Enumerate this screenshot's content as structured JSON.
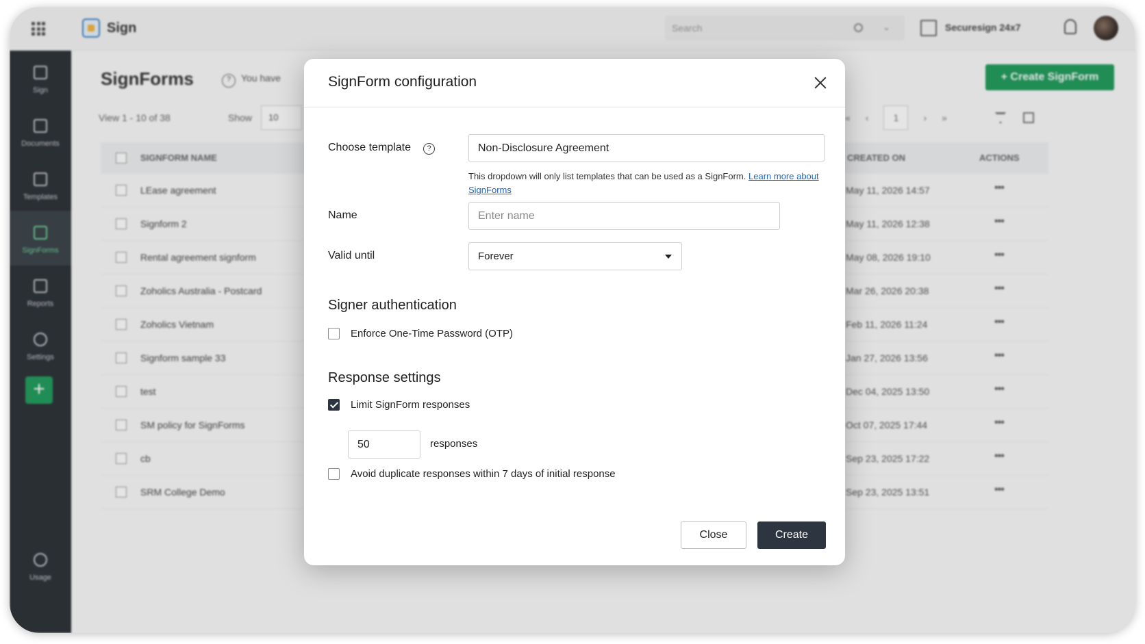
{
  "header": {
    "app_name": "Sign",
    "search_placeholder": "Search",
    "org_name": "Securesign 24x7",
    "icons": [
      "apps-grid-icon",
      "sign-logo-icon",
      "search-icon",
      "chevron-down-icon",
      "organization-icon",
      "bell-icon"
    ]
  },
  "sidebar": {
    "items": [
      {
        "label": "Sign",
        "icon": "home-icon"
      },
      {
        "label": "Documents",
        "icon": "documents-icon"
      },
      {
        "label": "Templates",
        "icon": "templates-icon"
      },
      {
        "label": "SignForms",
        "icon": "link-icon",
        "active": true
      },
      {
        "label": "Reports",
        "icon": "reports-icon"
      },
      {
        "label": "Settings",
        "icon": "gear-icon"
      }
    ],
    "usage_label": "Usage"
  },
  "page": {
    "title": "SignForms",
    "info_note": "You have",
    "create_button": "+ Create SignForm",
    "view_count": "View  1 - 10  of  38",
    "show_label": "Show",
    "show_value": "10",
    "current_page": "1",
    "pager": {
      "first": "«",
      "prev": "‹",
      "next": "›",
      "last": "»"
    }
  },
  "table": {
    "headers": {
      "name": "SIGNFORM NAME",
      "created": "CREATED ON",
      "actions": "ACTIONS"
    },
    "rows": [
      {
        "name": "LEase agreement",
        "created": "May 11, 2026 14:57"
      },
      {
        "name": "Signform 2",
        "created": "May 11, 2026 12:38"
      },
      {
        "name": "Rental agreement signform",
        "created": "May 08, 2026 19:10"
      },
      {
        "name": "Zoholics Australia - Postcard",
        "created": "Mar 26, 2026 20:38"
      },
      {
        "name": "Zoholics Vietnam",
        "created": "Feb 11, 2026 11:24"
      },
      {
        "name": "Signform sample 33",
        "created": "Jan 27, 2026 13:56"
      },
      {
        "name": "test",
        "created": "Dec 04, 2025 13:50"
      },
      {
        "name": "SM policy for SignForms",
        "created": "Oct 07, 2025 17:44"
      },
      {
        "name": "cb",
        "created": "Sep 23, 2025 17:22"
      },
      {
        "name": "SRM College Demo",
        "created": "Sep 23, 2025 13:51"
      }
    ],
    "more_glyph": "•••"
  },
  "modal": {
    "title": "SignForm configuration",
    "template_label": "Choose template",
    "template_value": "Non-Disclosure Agreement",
    "template_hint": "This dropdown will only list templates that can be used as a SignForm.",
    "learn_more": "Learn more about SignForms",
    "name_label": "Name",
    "name_placeholder": "Enter name",
    "valid_label": "Valid until",
    "valid_value": "Forever",
    "auth_title": "Signer authentication",
    "otp_label": "Enforce One-Time Password (OTP)",
    "otp_checked": false,
    "response_title": "Response settings",
    "limit_label": "Limit SignForm responses",
    "limit_checked": true,
    "limit_value": "50",
    "limit_suffix": "responses",
    "duplicate_label": "Avoid duplicate responses within 7 days of initial response",
    "duplicate_checked": false,
    "close_button": "Close",
    "create_button": "Create"
  },
  "colors": {
    "primary_green": "#1f9b5b",
    "sidebar_bg": "#2b3036",
    "create_button_bg": "#2d3640",
    "link_blue": "#1a66c2"
  }
}
